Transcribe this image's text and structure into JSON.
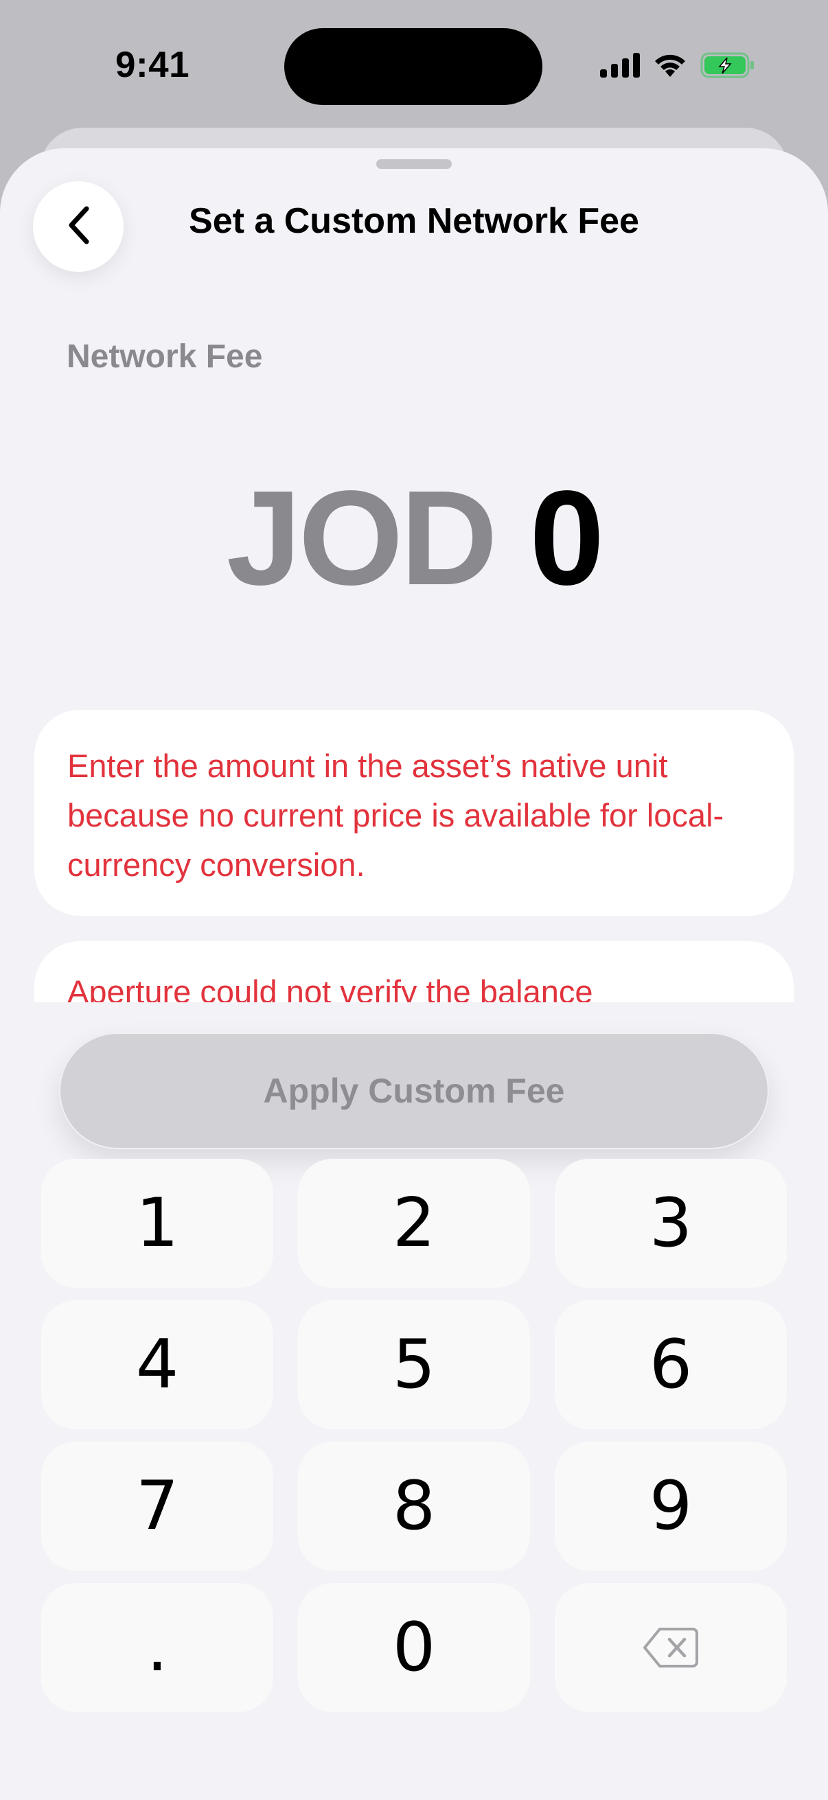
{
  "status_bar": {
    "time": "9:41"
  },
  "nav": {
    "title": "Set a Custom Network Fee",
    "back_icon": "chevron-left-icon"
  },
  "fee": {
    "label": "Network Fee",
    "currency": "JOD",
    "value": "0"
  },
  "messages": [
    "Enter the amount in the asset’s native unit because no current price is available for local-currency conversion.",
    "Aperture could not verify the balance"
  ],
  "apply_button": {
    "label": "Apply Custom Fee",
    "enabled": false
  },
  "keypad": {
    "keys": [
      "1",
      "2",
      "3",
      "4",
      "5",
      "6",
      "7",
      "8",
      "9",
      ".",
      "0"
    ],
    "delete_icon": "delete-backspace-icon"
  },
  "colors": {
    "warning": "#e2333d",
    "sheet_bg": "#f2f2f7",
    "muted_text": "#8a8a8e",
    "battery_green": "#34c759"
  }
}
